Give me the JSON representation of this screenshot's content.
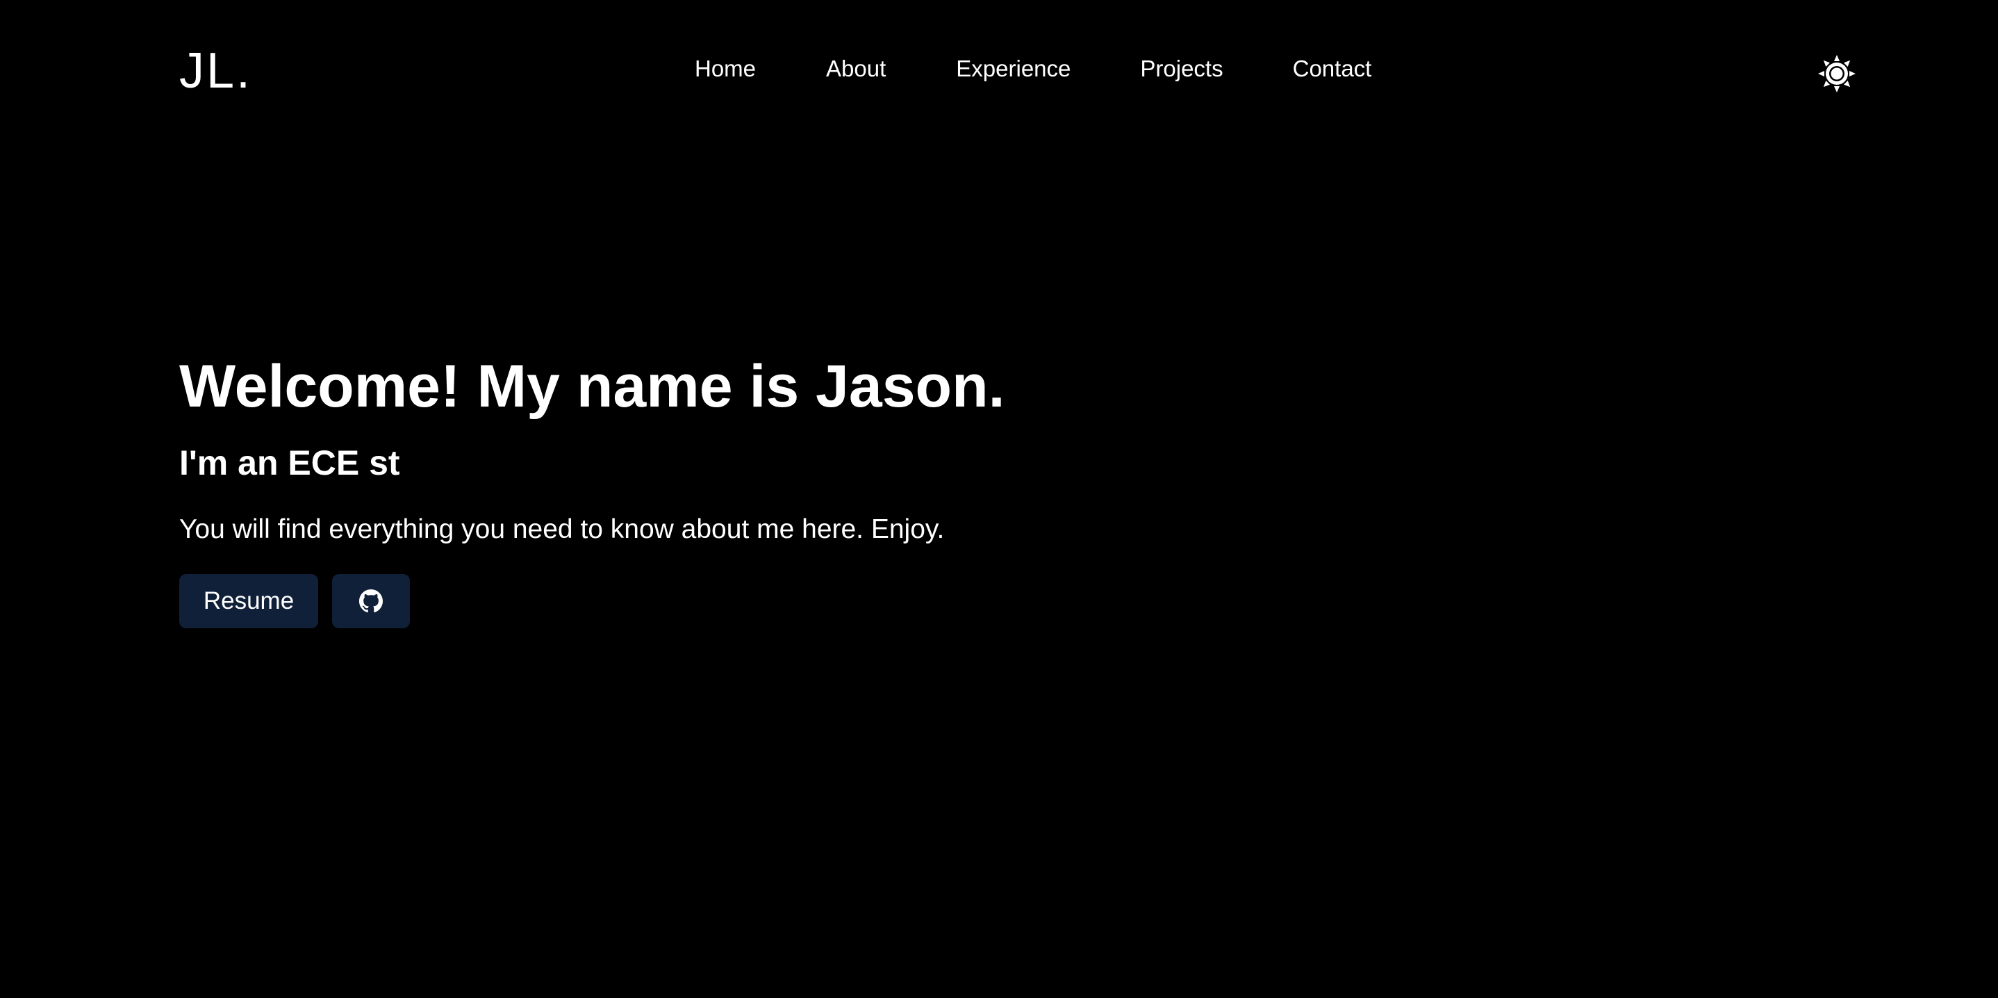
{
  "header": {
    "logo": "JL.",
    "nav": [
      {
        "label": "Home"
      },
      {
        "label": "About"
      },
      {
        "label": "Experience"
      },
      {
        "label": "Projects"
      },
      {
        "label": "Contact"
      }
    ],
    "theme_toggle_icon": "sun-icon"
  },
  "hero": {
    "title": "Welcome! My name is Jason.",
    "subtitle": "I'm an ECE st",
    "description": "You will find everything you need to know about me here. Enjoy.",
    "resume_label": "Resume",
    "github_icon": "github-icon"
  },
  "colors": {
    "background": "#000000",
    "text": "#ffffff",
    "button_bg": "#102039"
  }
}
